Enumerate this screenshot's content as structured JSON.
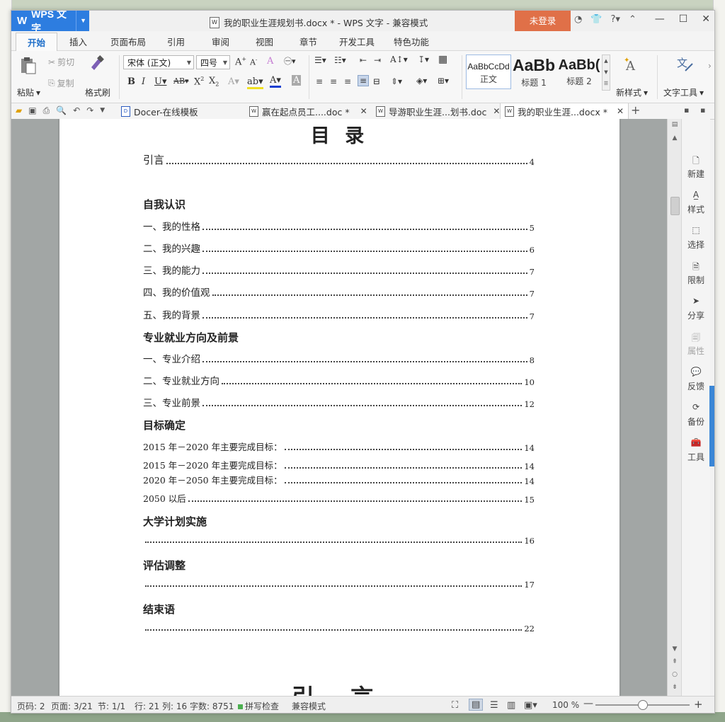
{
  "window": {
    "app_button": "WPS 文字",
    "title": "我的职业生涯规划书.docx * - WPS 文字 - 兼容模式",
    "login": "未登录"
  },
  "menu": {
    "tabs": [
      "开始",
      "插入",
      "页面布局",
      "引用",
      "审阅",
      "视图",
      "章节",
      "开发工具",
      "特色功能"
    ]
  },
  "ribbon": {
    "paste": "粘贴",
    "cut": "剪切",
    "copy": "复制",
    "format_painter": "格式刷",
    "font_name": "宋体 (正文)",
    "font_size": "四号",
    "styles": [
      {
        "preview": "AaBbCcDd",
        "name": "正文"
      },
      {
        "preview": "AaBb",
        "name": "标题 1"
      },
      {
        "preview": "AaBb(",
        "name": "标题 2"
      }
    ],
    "new_style": "新样式",
    "text_tools": "文字工具"
  },
  "doc_tabs": [
    {
      "label": "Docer-在线模板"
    },
    {
      "label": "赢在起点员工....doc *"
    },
    {
      "label": "导游职业生涯...划书.doc"
    },
    {
      "label": "我的职业生涯...docx *"
    }
  ],
  "document": {
    "toc_title": "目 录",
    "entries": [
      {
        "text": "引言",
        "page": "4"
      },
      {
        "text": "自我认识",
        "page": ""
      },
      {
        "text": "一、我的性格",
        "page": "5"
      },
      {
        "text": "二、我的兴趣",
        "page": "6"
      },
      {
        "text": "三、我的能力",
        "page": "7"
      },
      {
        "text": "四、我的价值观",
        "page": "7"
      },
      {
        "text": "五、我的背景",
        "page": "7"
      },
      {
        "text": "专业就业方向及前景",
        "page": ""
      },
      {
        "text": "一、专业介绍",
        "page": "8"
      },
      {
        "text": "二、专业就业方向",
        "page": "10"
      },
      {
        "text": "三、专业前景",
        "page": "12"
      },
      {
        "text": "目标确定",
        "page": ""
      },
      {
        "text": "2015 年－2020 年主要完成目标：",
        "page": "14"
      },
      {
        "text": "2015 年－2020 年主要完成目标：",
        "page": "14"
      },
      {
        "text": "2020 年－2050 年主要完成目标：",
        "page": "14"
      },
      {
        "text": "2050 以后",
        "page": "15"
      },
      {
        "text": "大学计划实施",
        "page": ""
      },
      {
        "text": "",
        "page": "16"
      },
      {
        "text": "评估调整",
        "page": ""
      },
      {
        "text": "",
        "page": "17"
      },
      {
        "text": "结束语",
        "page": ""
      },
      {
        "text": "",
        "page": "22"
      }
    ],
    "next_heading": "引 言"
  },
  "side_pane": [
    "新建",
    "样式",
    "选择",
    "限制",
    "分享",
    "属性",
    "反馈",
    "备份",
    "工具"
  ],
  "status": {
    "page_code": "页码: 2",
    "pages": "页面: 3/21",
    "section": "节: 1/1",
    "line": "行: 21",
    "column": "列: 16",
    "word_count": "字数: 8751",
    "spell_check": "拼写检查",
    "compat_mode": "兼容模式",
    "zoom": "100 %"
  },
  "colors": {
    "accent": "#2d7de0",
    "login_bg": "#e07048"
  }
}
